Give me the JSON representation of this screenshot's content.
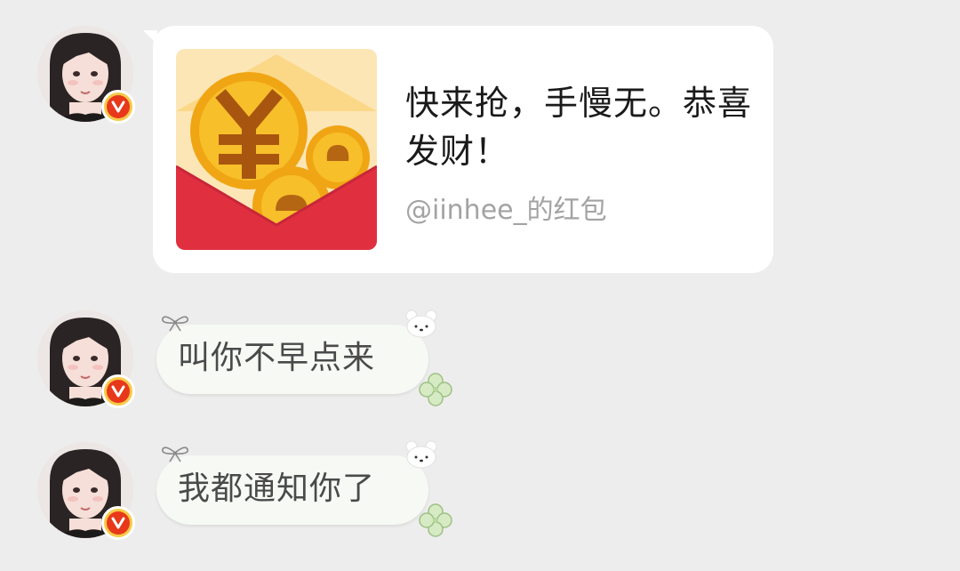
{
  "messages": [
    {
      "type": "red_packet",
      "avatar_icon": "avatar-photo",
      "badge_icon": "verified-v-icon",
      "title": "快来抢，手慢无。恭喜发财！",
      "sender": "@iinhee_的红包",
      "illustration_icon": "red-envelope-coin-icon"
    },
    {
      "type": "text",
      "avatar_icon": "avatar-photo",
      "badge_icon": "verified-v-icon",
      "text": "叫你不早点来"
    },
    {
      "type": "text",
      "avatar_icon": "avatar-photo",
      "badge_icon": "verified-v-icon",
      "text": "我都通知你了"
    }
  ],
  "colors": {
    "background": "#ededed",
    "card": "#ffffff",
    "envelope_red": "#e0303f",
    "envelope_flap": "#fde6b6",
    "coin_gold": "#f5b71f",
    "badge_ring": "#f7c948",
    "badge_red": "#e8381a",
    "sender_text": "#a3a3a3",
    "bubble": "#f7f9f5"
  },
  "bubble_decorations": [
    "ribbon-bow-icon",
    "bear-head-icon",
    "clover-icon"
  ]
}
